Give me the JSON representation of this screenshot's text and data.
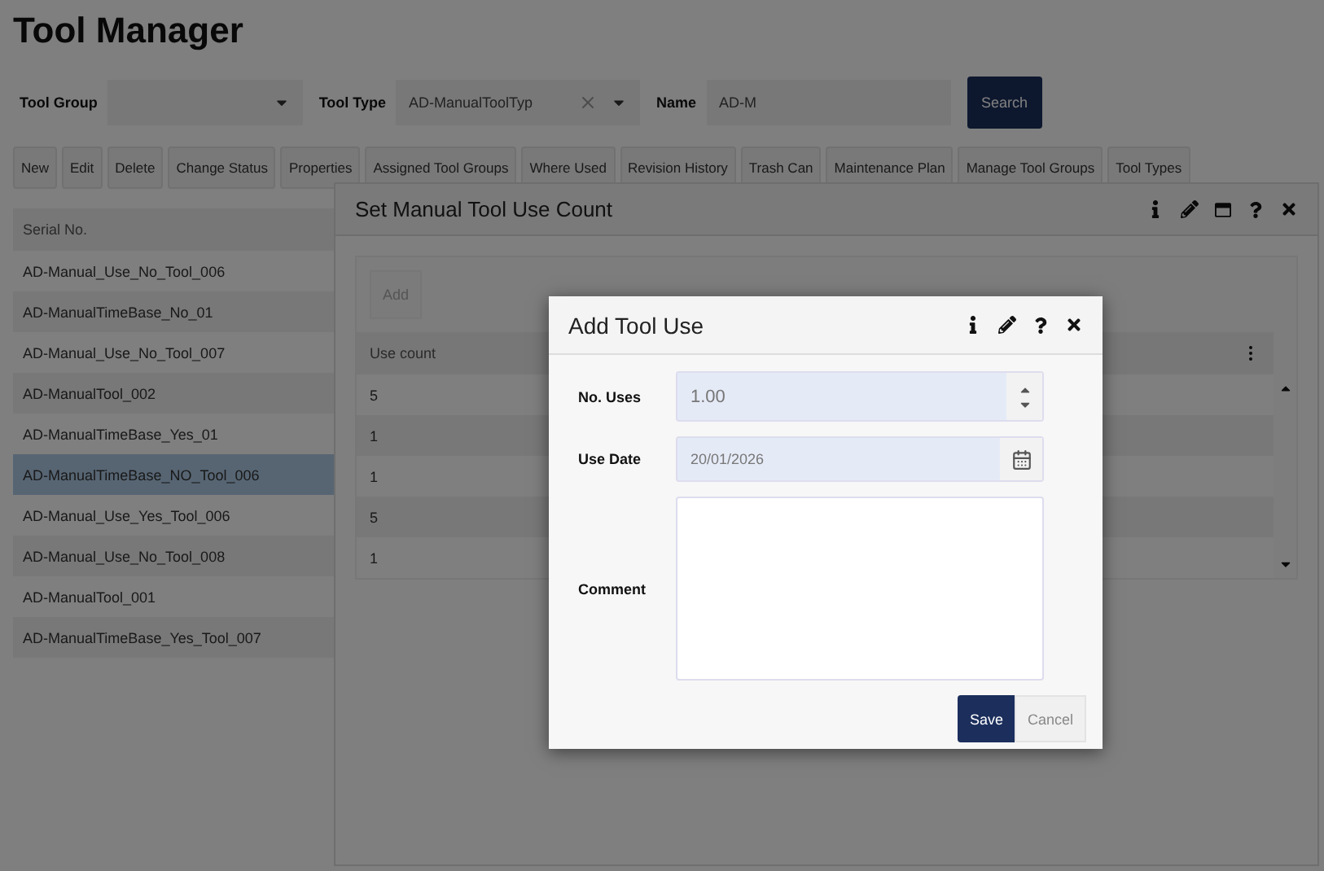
{
  "page": {
    "title": "Tool Manager"
  },
  "filters": [
    {
      "label": "Tool Group",
      "kind": "select",
      "clearable": false
    },
    {
      "label": "Tool Type",
      "kind": "select",
      "value": "AD-ManualToolTyp",
      "clearable": true
    },
    {
      "label": "Name",
      "kind": "text",
      "value": "AD-M"
    }
  ],
  "search_button": "Search",
  "toolbar": [
    "New",
    "Edit",
    "Delete",
    "Change Status",
    "Properties",
    "Assigned Tool Groups",
    "Where Used",
    "Revision History",
    "Trash Can",
    "Maintenance Plan",
    "Manage Tool Groups",
    "Tool Types"
  ],
  "serial_table": {
    "column": "Serial No.",
    "rows": [
      {
        "text": "AD-Manual_Use_No_Tool_006",
        "selected": false
      },
      {
        "text": "AD-ManualTimeBase_No_01",
        "selected": false
      },
      {
        "text": "AD-Manual_Use_No_Tool_007",
        "selected": false
      },
      {
        "text": "AD-ManualTool_002",
        "selected": false
      },
      {
        "text": "AD-ManualTimeBase_Yes_01",
        "selected": false
      },
      {
        "text": "AD-ManualTimeBase_NO_Tool_006",
        "selected": true
      },
      {
        "text": "AD-Manual_Use_Yes_Tool_006",
        "selected": false
      },
      {
        "text": "AD-Manual_Use_No_Tool_008",
        "selected": false
      },
      {
        "text": "AD-ManualTool_001",
        "selected": false
      },
      {
        "text": "AD-ManualTimeBase_Yes_Tool_007",
        "selected": false
      }
    ]
  },
  "use_count_dialog": {
    "title": "Set Manual Tool Use Count",
    "add_button": {
      "label": "Add",
      "disabled": true
    },
    "column": "Use count",
    "rows": [
      "5",
      "1",
      "1",
      "5",
      "1"
    ]
  },
  "add_tool_use_dialog": {
    "title": "Add Tool Use",
    "fields": [
      {
        "label": "No. Uses",
        "kind": "number",
        "value": "1.00"
      },
      {
        "label": "Use Date",
        "kind": "date",
        "value": "20/01/2026"
      },
      {
        "label": "Comment",
        "kind": "textarea"
      }
    ],
    "save_button": "Save",
    "cancel_button": "Cancel"
  }
}
